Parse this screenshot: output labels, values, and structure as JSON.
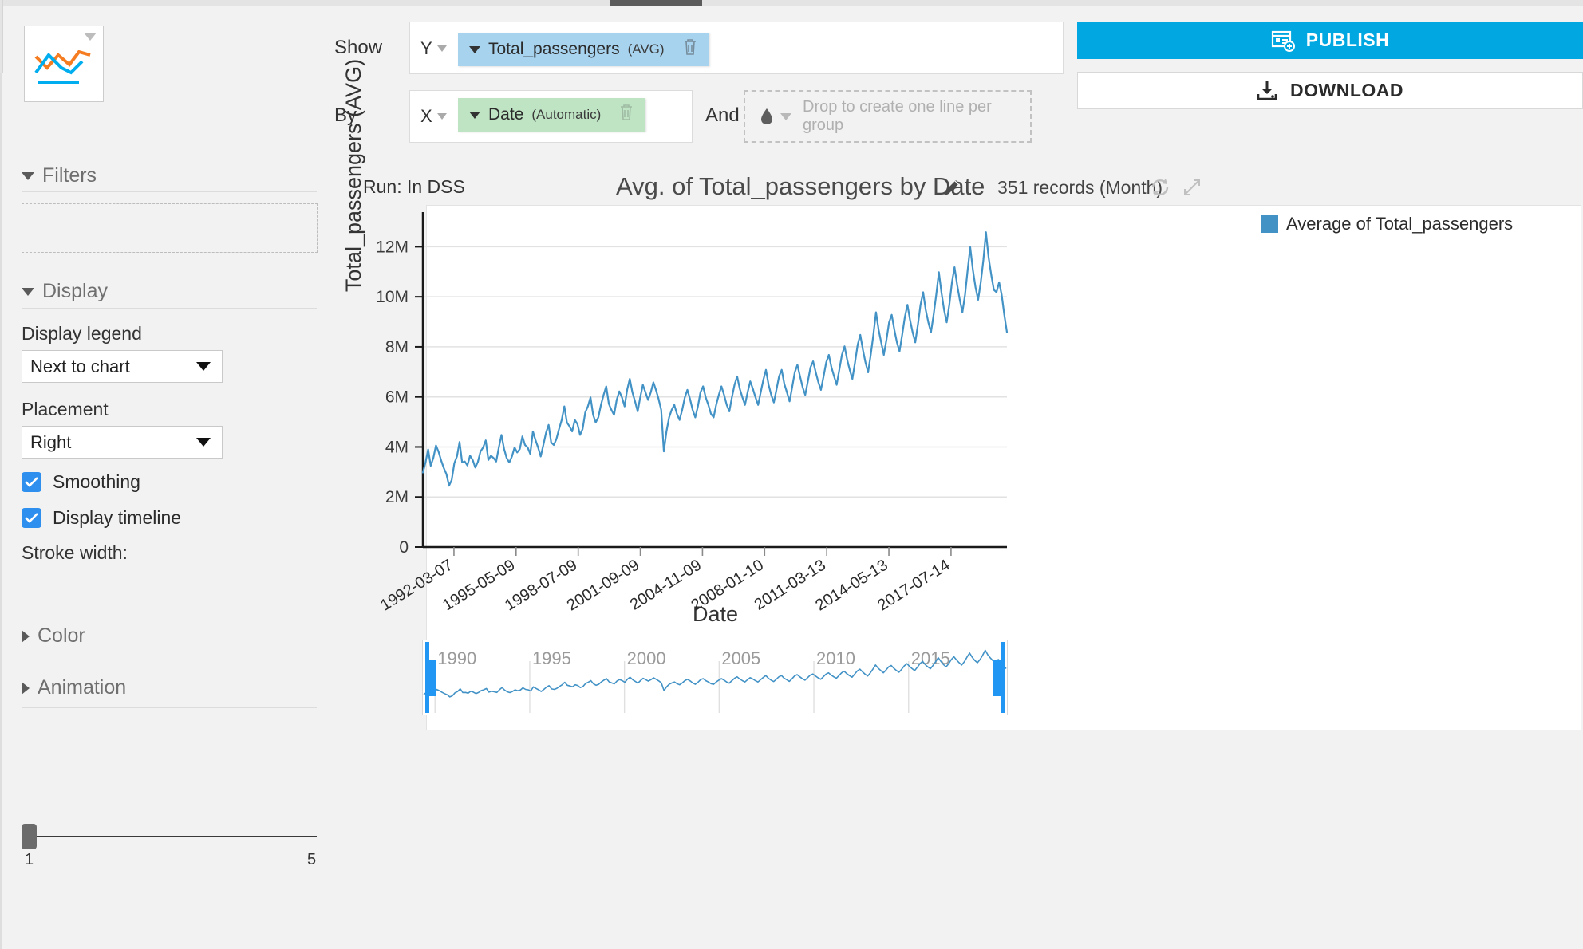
{
  "topbar": {
    "active_tab": ""
  },
  "chart_type": {
    "name": "line-chart-thumbnail",
    "caret": "chevron-down-icon"
  },
  "controls": {
    "show_label": "Show",
    "by_label": "By",
    "and_label": "And",
    "y_axis_selector": "Y",
    "x_axis_selector": "X",
    "y_measure": {
      "field": "Total_passengers",
      "aggregation": "(AVG)"
    },
    "x_dimension": {
      "field": "Date",
      "mode": "(Automatic)"
    },
    "group_dropzone_placeholder": "Drop to create one line per group"
  },
  "actions": {
    "publish_label": "PUBLISH",
    "download_label": "DOWNLOAD",
    "publish_color": "#00a7e1"
  },
  "sidebar": {
    "filters": {
      "title": "Filters",
      "expanded": true
    },
    "display": {
      "title": "Display",
      "expanded": true,
      "display_legend_label": "Display legend",
      "display_legend_value": "Next to chart",
      "placement_label": "Placement",
      "placement_value": "Right",
      "smoothing_label": "Smoothing",
      "smoothing_checked": true,
      "display_timeline_label": "Display timeline",
      "display_timeline_checked": true,
      "stroke_width_label": "Stroke width:",
      "stroke_width_min": "1",
      "stroke_width_max": "5",
      "stroke_width_value": 1
    },
    "color": {
      "title": "Color",
      "expanded": false
    },
    "animation": {
      "title": "Animation",
      "expanded": false
    }
  },
  "chart_card": {
    "run_label": "Run: In DSS",
    "title": "Avg. of Total_passengers by Date",
    "records": "351 records (Month)",
    "edit_icon": "pencil-icon",
    "refresh_icon": "refresh-icon",
    "expand_icon": "expand-icon"
  },
  "chart_data": {
    "type": "line",
    "title": "Avg. of Total_passengers by Date",
    "xlabel": "Date",
    "ylabel": "Total_passengers (AVG)",
    "legend": [
      "Average of Total_passengers"
    ],
    "legend_position": "right",
    "series_color": "#4292c6",
    "grid": true,
    "ylim": [
      0,
      13000000
    ],
    "ytick_labels": [
      "0",
      "2M",
      "4M",
      "6M",
      "8M",
      "10M",
      "12M"
    ],
    "ytick_values": [
      0,
      2000000,
      4000000,
      6000000,
      8000000,
      10000000,
      12000000
    ],
    "xtick_labels": [
      "1992-03-07",
      "1995-05-09",
      "1998-07-09",
      "2001-09-09",
      "2004-11-09",
      "2008-01-10",
      "2011-03-13",
      "2014-05-13",
      "2017-07-14"
    ],
    "records_count": 351,
    "aggregation": "Month",
    "series": [
      {
        "name": "Average of Total_passengers",
        "values": [
          2980000,
          3380000,
          3900000,
          3250000,
          3560000,
          4060000,
          3800000,
          3450000,
          3150000,
          2920000,
          2450000,
          2680000,
          3350000,
          3620000,
          4200000,
          3380000,
          3420000,
          3260000,
          3650000,
          3480000,
          3180000,
          3400000,
          3820000,
          3980000,
          4260000,
          3480000,
          3650000,
          3560000,
          3420000,
          3980000,
          4480000,
          3920000,
          3560000,
          3380000,
          3620000,
          3980000,
          3780000,
          3920000,
          4420000,
          4080000,
          3980000,
          3720000,
          4620000,
          4280000,
          3980000,
          3620000,
          4080000,
          4560000,
          4880000,
          4180000,
          4080000,
          4320000,
          4720000,
          5080000,
          5620000,
          4980000,
          4820000,
          4620000,
          5080000,
          4920000,
          4480000,
          4720000,
          5380000,
          5620000,
          5980000,
          5280000,
          4980000,
          5180000,
          5680000,
          6080000,
          6420000,
          5720000,
          5480000,
          5280000,
          5880000,
          6220000,
          5980000,
          5620000,
          6280000,
          6720000,
          6180000,
          5820000,
          5420000,
          5980000,
          6480000,
          6180000,
          5880000,
          6180000,
          6580000,
          6280000,
          5920000,
          5480000,
          3820000,
          4620000,
          5180000,
          5480000,
          5680000,
          5320000,
          5080000,
          5480000,
          5980000,
          6280000,
          5920000,
          5480000,
          5180000,
          5620000,
          6180000,
          6420000,
          5980000,
          5680000,
          5320000,
          5180000,
          5680000,
          6080000,
          6420000,
          6080000,
          5680000,
          5420000,
          5980000,
          6480000,
          6820000,
          6320000,
          5980000,
          5680000,
          6180000,
          6620000,
          6320000,
          5980000,
          5680000,
          6180000,
          6680000,
          7080000,
          6480000,
          6080000,
          5780000,
          6280000,
          6820000,
          7080000,
          6520000,
          6180000,
          5820000,
          6380000,
          6980000,
          7280000,
          6820000,
          6380000,
          6080000,
          6620000,
          7180000,
          7420000,
          6980000,
          6580000,
          6280000,
          6820000,
          7380000,
          7680000,
          7180000,
          6820000,
          6480000,
          7080000,
          7680000,
          8020000,
          7480000,
          7080000,
          6720000,
          7380000,
          8080000,
          8480000,
          7880000,
          7380000,
          6980000,
          7680000,
          8480000,
          9380000,
          8680000,
          8180000,
          7680000,
          8280000,
          8980000,
          9280000,
          8680000,
          8180000,
          7820000,
          8480000,
          9180000,
          9680000,
          9080000,
          8580000,
          8180000,
          8880000,
          9680000,
          10180000,
          9480000,
          8980000,
          8580000,
          9280000,
          10080000,
          10980000,
          10180000,
          9480000,
          8980000,
          9680000,
          10580000,
          11180000,
          10480000,
          9880000,
          9380000,
          10080000,
          11080000,
          11980000,
          11080000,
          10380000,
          9880000,
          10580000,
          11480000,
          12580000,
          11580000,
          10880000,
          10280000,
          10180000,
          10580000,
          10080000,
          9280000,
          8580000
        ]
      }
    ]
  },
  "timeline": {
    "year_labels": [
      "1990",
      "1995",
      "2000",
      "2005",
      "2010",
      "2015"
    ],
    "brush_left_handle": "brush-left-handle",
    "brush_right_handle": "brush-right-handle",
    "handle_color": "#2196f3"
  }
}
